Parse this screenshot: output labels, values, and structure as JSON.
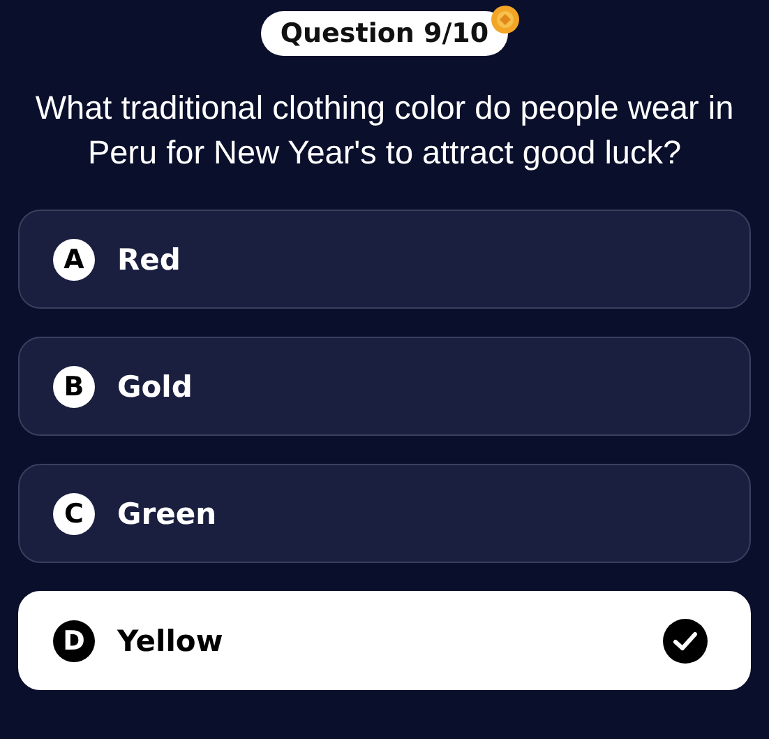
{
  "progress": {
    "label": "Question 9/10"
  },
  "question": "What traditional clothing color do people wear in Peru for New Year's to attract good luck?",
  "options": [
    {
      "letter": "A",
      "label": "Red",
      "selected": false
    },
    {
      "letter": "B",
      "label": "Gold",
      "selected": false
    },
    {
      "letter": "C",
      "label": "Green",
      "selected": false
    },
    {
      "letter": "D",
      "label": "Yellow",
      "selected": true
    }
  ]
}
